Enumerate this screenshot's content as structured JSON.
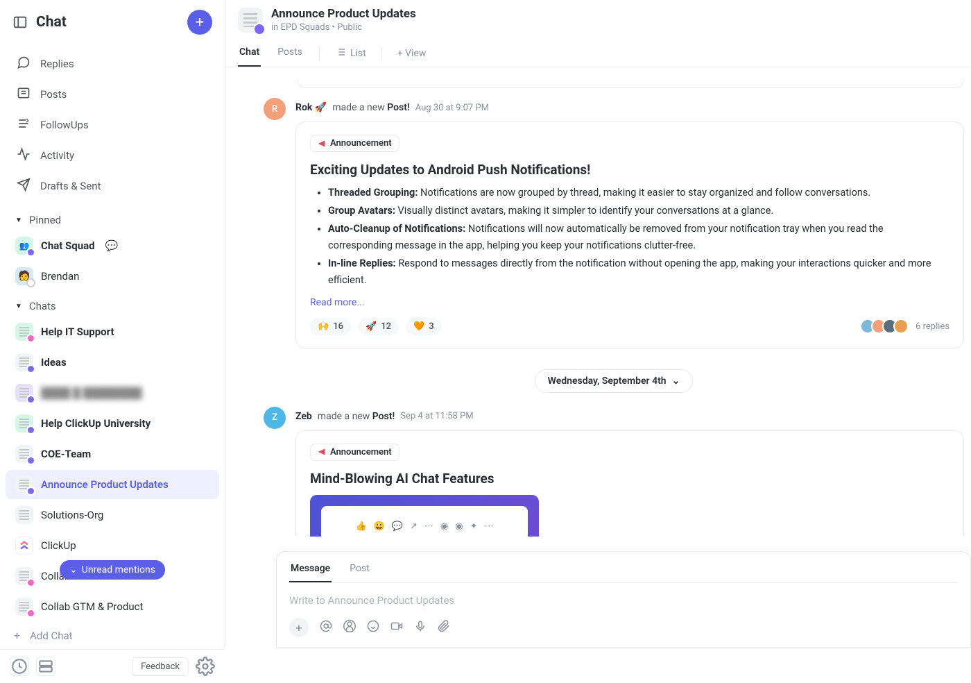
{
  "sidebar": {
    "title": "Chat",
    "nav": {
      "replies": "Replies",
      "posts": "Posts",
      "followups": "FollowUps",
      "activity": "Activity",
      "drafts": "Drafts & Sent"
    },
    "sections": {
      "pinned": {
        "label": "Pinned",
        "items": [
          {
            "label": "Chat Squad",
            "bold": true
          },
          {
            "label": "Brendan"
          }
        ]
      },
      "chats": {
        "label": "Chats",
        "items": [
          {
            "label": "Help IT Support",
            "bold": true
          },
          {
            "label": "Ideas",
            "bold": true
          },
          {
            "label": "████ █ ████████",
            "blurred": true
          },
          {
            "label": "Help ClickUp University",
            "bold": true
          },
          {
            "label": "COE-Team",
            "bold": true
          },
          {
            "label": "Announce Product Updates",
            "active": true
          },
          {
            "label": "Solutions-Org"
          },
          {
            "label": "ClickUp",
            "clickup": true
          },
          {
            "label": "Collab Growth Website"
          },
          {
            "label": "Collab GTM & Product"
          }
        ],
        "add_label": "Add Chat"
      }
    },
    "unread_pill": "Unread mentions",
    "feedback_btn": "Feedback"
  },
  "header": {
    "title": "Announce Product Updates",
    "location": "in EPD Squads",
    "visibility": "Public",
    "tabs": {
      "chat": "Chat",
      "posts": "Posts",
      "list": "List",
      "view": "+ View"
    }
  },
  "feed": {
    "post1": {
      "author": "Rok 🚀",
      "action": "made a new",
      "action_obj": "Post!",
      "date": "Aug 30 at 9:07 PM",
      "badge": "Announcement",
      "title": "Exciting Updates to Android Push Notifications!",
      "bullets": [
        {
          "b": "Threaded Grouping:",
          "t": "Notifications are now grouped by thread, making it easier to stay organized and follow conversations."
        },
        {
          "b": "Group Avatars:",
          "t": "Visually distinct avatars, making it simpler to identify your conversations at a glance."
        },
        {
          "b": "Auto-Cleanup of Notifications:",
          "t": "Notifications will now automatically be removed from your notification tray when you read the corresponding message in the app, helping you keep your notifications clutter-free."
        },
        {
          "b": "In-line Replies:",
          "t": "Respond to messages directly from the notification without opening the app, making your interactions quicker and more efficient."
        }
      ],
      "readmore": "Read more...",
      "reactions": [
        {
          "emoji": "🙌",
          "count": "16"
        },
        {
          "emoji": "🚀",
          "count": "12"
        },
        {
          "emoji": "🧡",
          "count": "3"
        }
      ],
      "reply_count": "6 replies"
    },
    "date_divider": "Wednesday, September 4th",
    "post2": {
      "author": "Zeb",
      "action": "made a new",
      "action_obj": "Post!",
      "date": "Sep 4 at 11:58 PM",
      "badge": "Announcement",
      "title": "Mind-Blowing AI Chat Features"
    }
  },
  "composer": {
    "tabs": {
      "message": "Message",
      "post": "Post"
    },
    "placeholder": "Write to Announce Product Updates"
  }
}
